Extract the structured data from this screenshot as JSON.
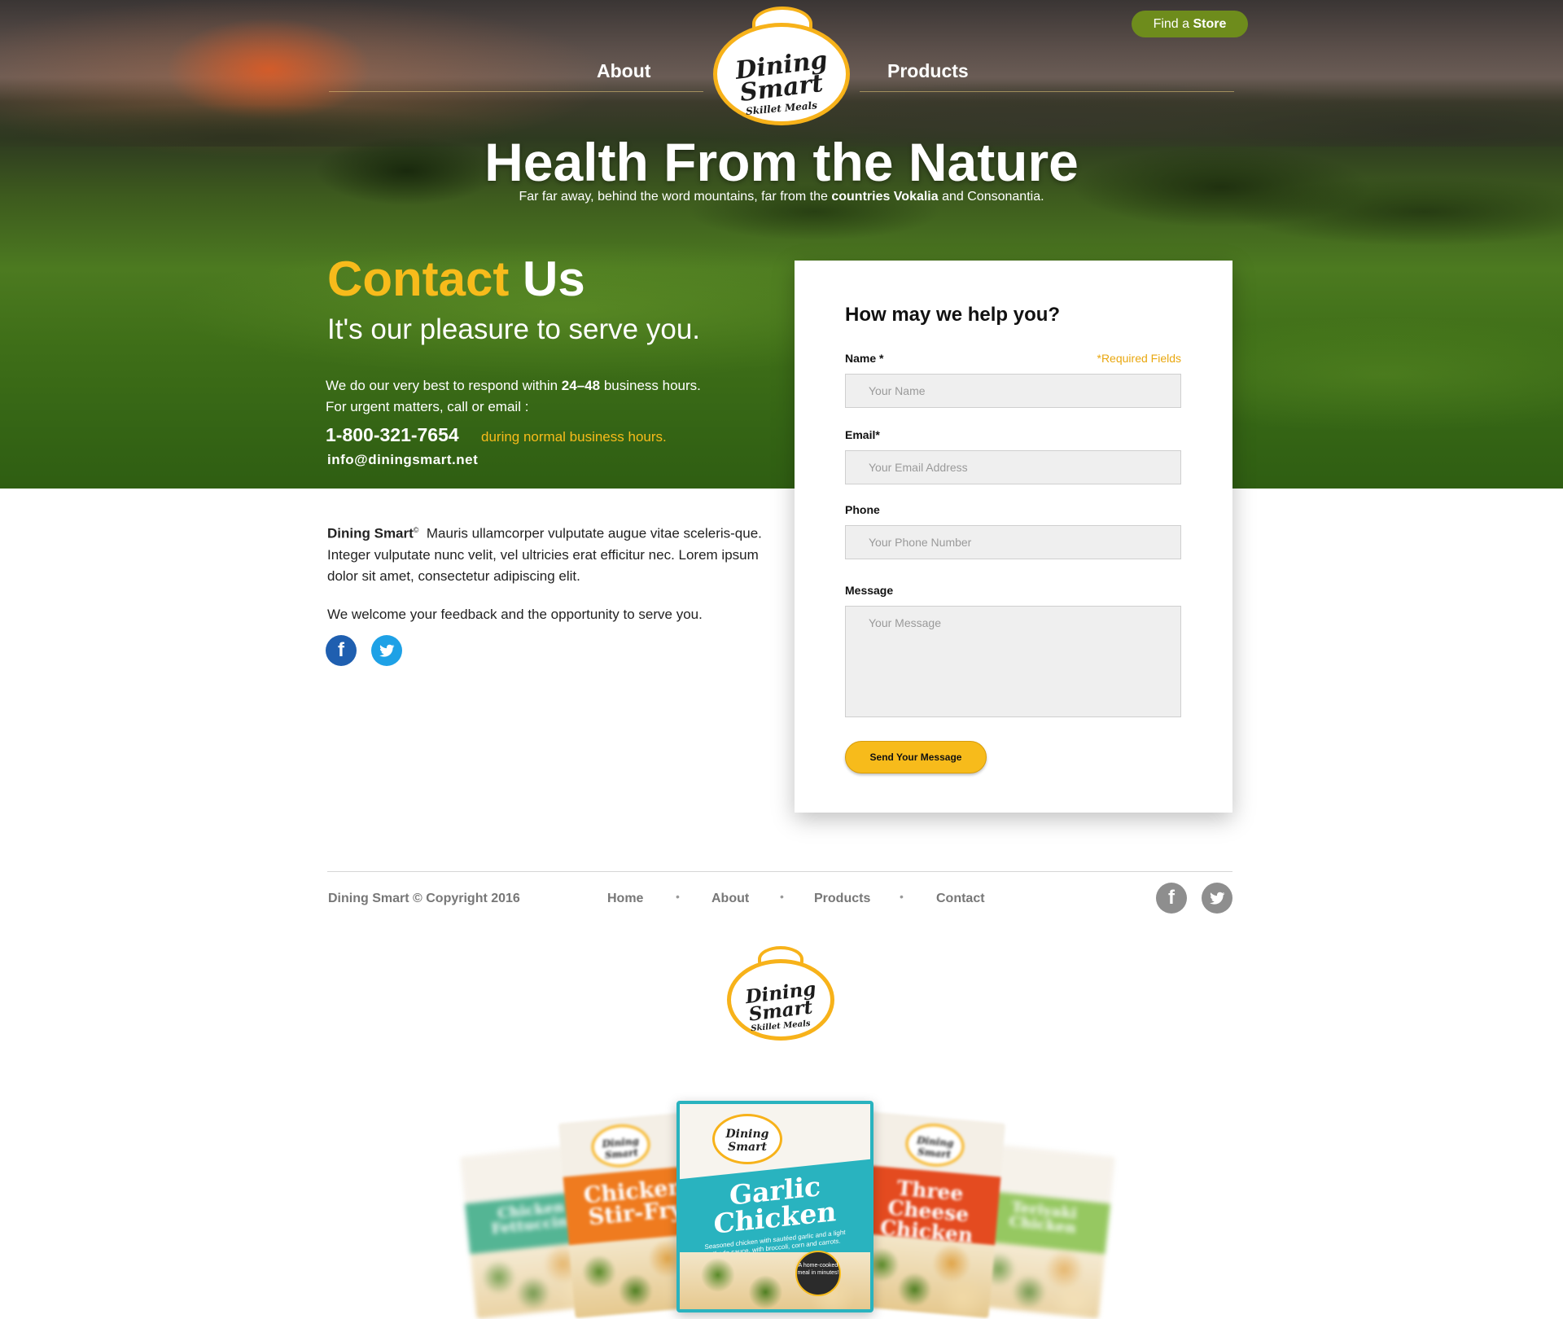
{
  "colors": {
    "accent_yellow": "#f7bb1b",
    "store_green": "#6e8c1c",
    "facebook_blue": "#1f5fb0",
    "twitter_blue": "#1ea1e6"
  },
  "header": {
    "find_store_prefix": "Find a",
    "find_store_bold": "Store",
    "nav_left": "About",
    "nav_right": "Products",
    "logo": {
      "line1": "Dining",
      "line2": "Smart",
      "tagline": "Skillet Meals"
    }
  },
  "hero": {
    "title": "Health From the Nature",
    "subtitle_pre": "Far far away, behind the word mountains, far from the",
    "subtitle_bold": "countries Vokalia",
    "subtitle_post": "and Consonantia."
  },
  "contact": {
    "heading_yellow": "Contact",
    "heading_white": "Us",
    "tagline": "It's our pleasure to serve you.",
    "respond_pre": "We do our very best to respond within",
    "respond_bold": "24–48",
    "respond_post": "business hours.",
    "urgent": "For urgent matters, call or email :",
    "phone": "1-800-321-7654",
    "phone_note": "during normal business hours.",
    "email": "info@diningsmart.net"
  },
  "about": {
    "brand": "Dining Smart",
    "brand_mark": "©",
    "paragraph": "Mauris ullamcorper vulputate augue vitae sceleris-que. Integer vulputate nunc velit, vel ultricies erat efficitur nec. Lorem ipsum dolor sit amet, consectetur adipiscing elit.",
    "feedback": "We welcome your feedback and the opportunity to serve you.",
    "social": {
      "facebook_icon": "facebook-icon",
      "twitter_icon": "twitter-icon"
    }
  },
  "form": {
    "title": "How may we help you?",
    "required_note": "*Required Fields",
    "name_label": "Name *",
    "name_placeholder": "Your Name",
    "name_value": "",
    "email_label": "Email*",
    "email_placeholder": "Your Email Address",
    "email_value": "",
    "phone_label": "Phone",
    "phone_placeholder": "Your Phone Number",
    "phone_value": "",
    "message_label": "Message",
    "message_placeholder": "Your Message",
    "message_value": "",
    "submit_label": "Send Your Message"
  },
  "footer": {
    "copyright": "Dining Smart © Copyright 2016",
    "nav": [
      "Home",
      "About",
      "Products",
      "Contact"
    ],
    "separator": "•",
    "logo": {
      "line1": "Dining",
      "line2": "Smart",
      "tagline": "Skillet Meals"
    }
  },
  "products": [
    {
      "line1": "Chicken",
      "line2": "Fettuccini",
      "color": "#2aa37a"
    },
    {
      "line1": "Chicken",
      "line2": "Stir-Fry",
      "color": "#ef7b1f"
    },
    {
      "line1": "Garlic",
      "line2": "Chicken",
      "color": "#29b3bf",
      "desc": "Seasoned chicken with sautéed garlic and a light alfredo sauce, with broccoli, corn and carrots.",
      "badge": "A home-cooked meal in minutes!"
    },
    {
      "line1": "Three",
      "line2": "Cheese Chicken",
      "color": "#e44b20"
    },
    {
      "line1": "Teriyaki",
      "line2": "Chicken",
      "color": "#7cbb3a"
    }
  ],
  "product_logo": {
    "line1": "Dining",
    "line2": "Smart",
    "tagline": "Skillet Meals"
  }
}
